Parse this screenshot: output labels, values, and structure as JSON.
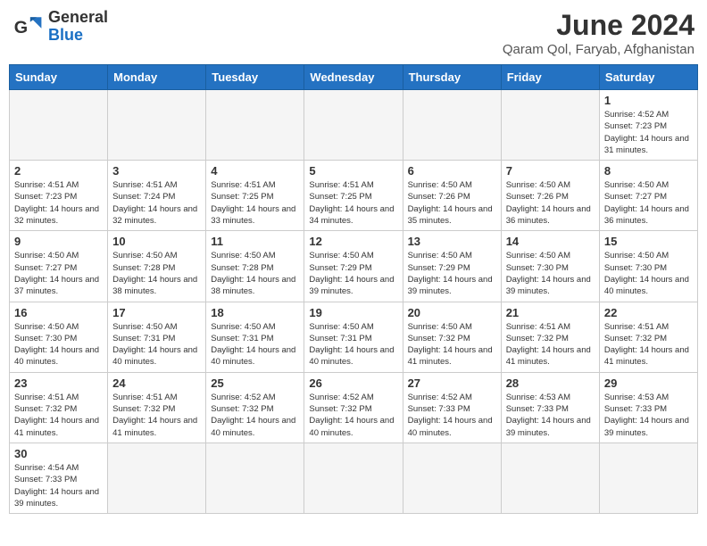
{
  "header": {
    "logo_text_regular": "General",
    "logo_text_blue": "Blue",
    "title": "June 2024",
    "subtitle": "Qaram Qol, Faryab, Afghanistan"
  },
  "weekdays": [
    "Sunday",
    "Monday",
    "Tuesday",
    "Wednesday",
    "Thursday",
    "Friday",
    "Saturday"
  ],
  "days": [
    {
      "date": "",
      "info": ""
    },
    {
      "date": "",
      "info": ""
    },
    {
      "date": "",
      "info": ""
    },
    {
      "date": "",
      "info": ""
    },
    {
      "date": "",
      "info": ""
    },
    {
      "date": "",
      "info": ""
    },
    {
      "date": "1",
      "info": "Sunrise: 4:52 AM\nSunset: 7:23 PM\nDaylight: 14 hours and 31 minutes."
    },
    {
      "date": "2",
      "info": "Sunrise: 4:51 AM\nSunset: 7:23 PM\nDaylight: 14 hours and 32 minutes."
    },
    {
      "date": "3",
      "info": "Sunrise: 4:51 AM\nSunset: 7:24 PM\nDaylight: 14 hours and 32 minutes."
    },
    {
      "date": "4",
      "info": "Sunrise: 4:51 AM\nSunset: 7:25 PM\nDaylight: 14 hours and 33 minutes."
    },
    {
      "date": "5",
      "info": "Sunrise: 4:51 AM\nSunset: 7:25 PM\nDaylight: 14 hours and 34 minutes."
    },
    {
      "date": "6",
      "info": "Sunrise: 4:50 AM\nSunset: 7:26 PM\nDaylight: 14 hours and 35 minutes."
    },
    {
      "date": "7",
      "info": "Sunrise: 4:50 AM\nSunset: 7:26 PM\nDaylight: 14 hours and 36 minutes."
    },
    {
      "date": "8",
      "info": "Sunrise: 4:50 AM\nSunset: 7:27 PM\nDaylight: 14 hours and 36 minutes."
    },
    {
      "date": "9",
      "info": "Sunrise: 4:50 AM\nSunset: 7:27 PM\nDaylight: 14 hours and 37 minutes."
    },
    {
      "date": "10",
      "info": "Sunrise: 4:50 AM\nSunset: 7:28 PM\nDaylight: 14 hours and 38 minutes."
    },
    {
      "date": "11",
      "info": "Sunrise: 4:50 AM\nSunset: 7:28 PM\nDaylight: 14 hours and 38 minutes."
    },
    {
      "date": "12",
      "info": "Sunrise: 4:50 AM\nSunset: 7:29 PM\nDaylight: 14 hours and 39 minutes."
    },
    {
      "date": "13",
      "info": "Sunrise: 4:50 AM\nSunset: 7:29 PM\nDaylight: 14 hours and 39 minutes."
    },
    {
      "date": "14",
      "info": "Sunrise: 4:50 AM\nSunset: 7:30 PM\nDaylight: 14 hours and 39 minutes."
    },
    {
      "date": "15",
      "info": "Sunrise: 4:50 AM\nSunset: 7:30 PM\nDaylight: 14 hours and 40 minutes."
    },
    {
      "date": "16",
      "info": "Sunrise: 4:50 AM\nSunset: 7:30 PM\nDaylight: 14 hours and 40 minutes."
    },
    {
      "date": "17",
      "info": "Sunrise: 4:50 AM\nSunset: 7:31 PM\nDaylight: 14 hours and 40 minutes."
    },
    {
      "date": "18",
      "info": "Sunrise: 4:50 AM\nSunset: 7:31 PM\nDaylight: 14 hours and 40 minutes."
    },
    {
      "date": "19",
      "info": "Sunrise: 4:50 AM\nSunset: 7:31 PM\nDaylight: 14 hours and 40 minutes."
    },
    {
      "date": "20",
      "info": "Sunrise: 4:50 AM\nSunset: 7:32 PM\nDaylight: 14 hours and 41 minutes."
    },
    {
      "date": "21",
      "info": "Sunrise: 4:51 AM\nSunset: 7:32 PM\nDaylight: 14 hours and 41 minutes."
    },
    {
      "date": "22",
      "info": "Sunrise: 4:51 AM\nSunset: 7:32 PM\nDaylight: 14 hours and 41 minutes."
    },
    {
      "date": "23",
      "info": "Sunrise: 4:51 AM\nSunset: 7:32 PM\nDaylight: 14 hours and 41 minutes."
    },
    {
      "date": "24",
      "info": "Sunrise: 4:51 AM\nSunset: 7:32 PM\nDaylight: 14 hours and 41 minutes."
    },
    {
      "date": "25",
      "info": "Sunrise: 4:52 AM\nSunset: 7:32 PM\nDaylight: 14 hours and 40 minutes."
    },
    {
      "date": "26",
      "info": "Sunrise: 4:52 AM\nSunset: 7:32 PM\nDaylight: 14 hours and 40 minutes."
    },
    {
      "date": "27",
      "info": "Sunrise: 4:52 AM\nSunset: 7:33 PM\nDaylight: 14 hours and 40 minutes."
    },
    {
      "date": "28",
      "info": "Sunrise: 4:53 AM\nSunset: 7:33 PM\nDaylight: 14 hours and 39 minutes."
    },
    {
      "date": "29",
      "info": "Sunrise: 4:53 AM\nSunset: 7:33 PM\nDaylight: 14 hours and 39 minutes."
    },
    {
      "date": "30",
      "info": "Sunrise: 4:54 AM\nSunset: 7:33 PM\nDaylight: 14 hours and 39 minutes."
    },
    {
      "date": "",
      "info": ""
    },
    {
      "date": "",
      "info": ""
    },
    {
      "date": "",
      "info": ""
    },
    {
      "date": "",
      "info": ""
    },
    {
      "date": "",
      "info": ""
    },
    {
      "date": "",
      "info": ""
    }
  ]
}
